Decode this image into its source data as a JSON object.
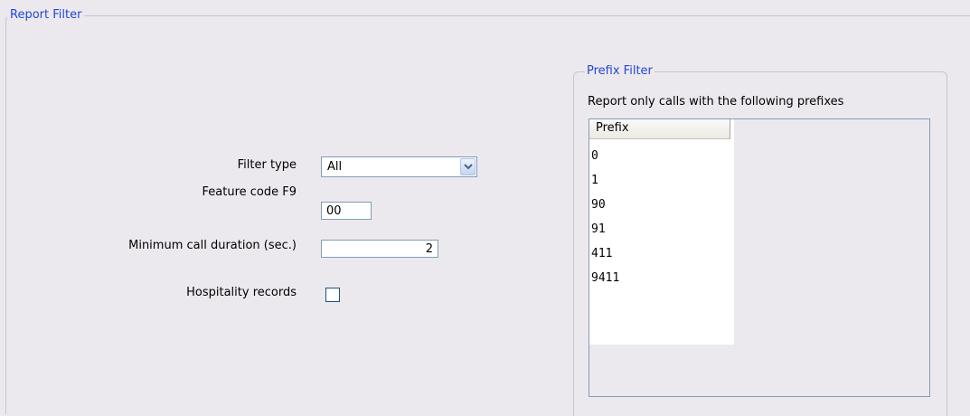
{
  "report_filter": {
    "legend": "Report Filter",
    "filter_type": {
      "label": "Filter type",
      "value": "All"
    },
    "feature_code": {
      "label": "Feature code F9",
      "value": "00"
    },
    "min_duration": {
      "label": "Minimum call duration (sec.)",
      "value": "2"
    },
    "hospitality": {
      "label": "Hospitality records",
      "checked": false
    }
  },
  "prefix_filter": {
    "legend": "Prefix Filter",
    "description": "Report only calls with the following prefixes",
    "column_header": "Prefix",
    "rows": [
      "0",
      "1",
      "90",
      "91",
      "411",
      "9411"
    ]
  },
  "icons": {
    "dropdown": "chevron-down-icon"
  },
  "colors": {
    "legend": "#2147d3",
    "background": "#ece9ee",
    "border": "#7f9db9"
  }
}
